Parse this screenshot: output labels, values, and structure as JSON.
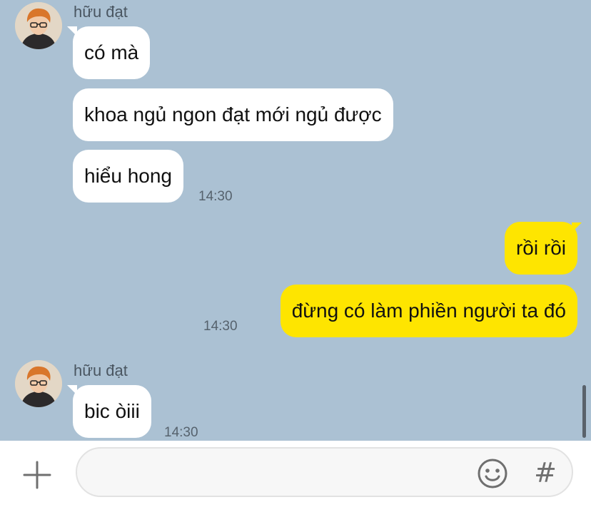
{
  "colors": {
    "chat_background": "#abc1d3",
    "incoming_bubble": "#ffffff",
    "outgoing_bubble": "#fee500",
    "icon_gray": "#6f6f6f"
  },
  "groups": [
    {
      "sender": "hữu đạt",
      "messages": [
        "có mà",
        "khoa ngủ ngon đạt mới ngủ được",
        "hiểu hong"
      ],
      "time": "14:30"
    },
    {
      "messages": [
        "rồi rồi",
        "đừng có làm phiền người ta đó"
      ],
      "time": "14:30"
    },
    {
      "sender": "hữu đạt",
      "messages": [
        "bic òiii"
      ],
      "time": "14:30"
    }
  ],
  "composer": {
    "value": "",
    "plus_icon": "plus-icon",
    "emoji_icon": "emoji-icon",
    "hash_label": "#"
  }
}
